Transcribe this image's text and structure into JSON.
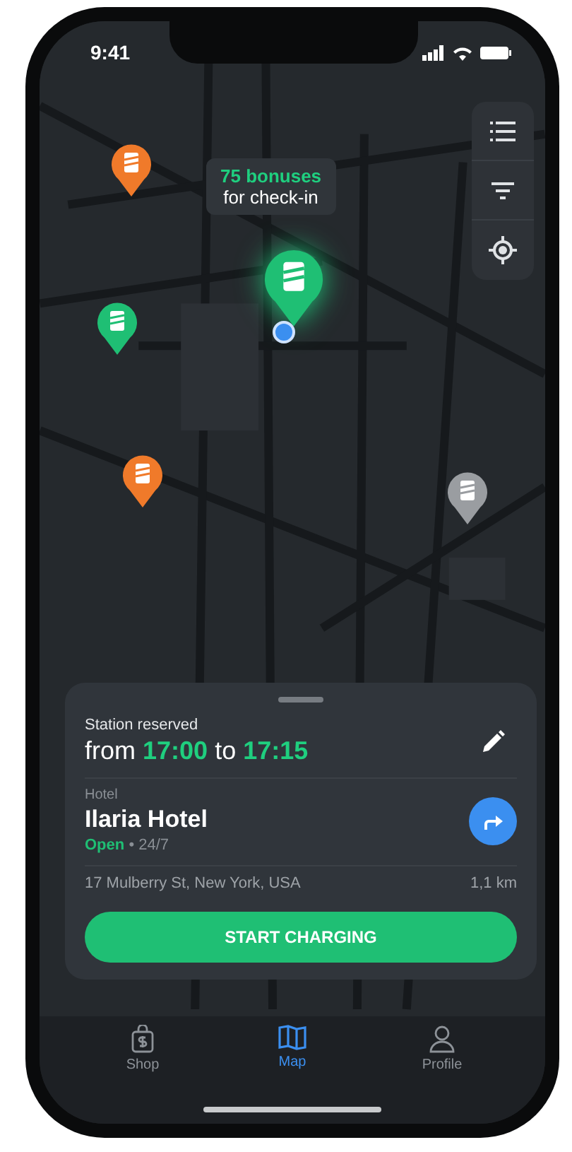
{
  "status_bar": {
    "time": "9:41"
  },
  "map": {
    "pins": [
      {
        "kind": "station",
        "color": "#f07a2a",
        "selected": false
      },
      {
        "kind": "station",
        "color": "#1fbf74",
        "selected": true
      },
      {
        "kind": "station",
        "color": "#1fbf74",
        "selected": false
      },
      {
        "kind": "station",
        "color": "#f07a2a",
        "selected": false
      },
      {
        "kind": "station",
        "color": "#9a9da1",
        "selected": false
      }
    ],
    "bonus_bubble": {
      "amount": "75 bonuses",
      "text": "for check-in"
    }
  },
  "reservation": {
    "label": "Station reserved",
    "from": "from",
    "start": "17:00",
    "to": "to",
    "end": "17:15"
  },
  "place": {
    "category": "Hotel",
    "name": "Ilaria Hotel",
    "status": "Open",
    "hours": "• 24/7",
    "address": "17 Mulberry St, New York, USA",
    "distance": "1,1 km"
  },
  "action_button": "START CHARGING",
  "tabs": [
    {
      "label": "Shop",
      "kind": "shop",
      "selected": false
    },
    {
      "label": "Map",
      "kind": "map",
      "selected": true
    },
    {
      "label": "Profile",
      "kind": "profile",
      "selected": false
    }
  ]
}
